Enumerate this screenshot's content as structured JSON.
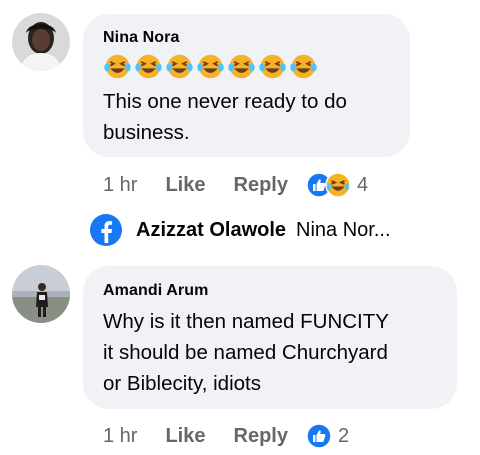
{
  "comments": [
    {
      "author": "Nina Nora",
      "emoji_row": [
        "laughing-tears-emoji",
        "laughing-tears-emoji",
        "laughing-tears-emoji",
        "laughing-tears-emoji",
        "laughing-tears-emoji",
        "laughing-tears-emoji",
        "laughing-tears-emoji"
      ],
      "text": "This one never ready to do\nbusiness.",
      "time": "1 hr",
      "like_label": "Like",
      "reply_label": "Reply",
      "reactions": [
        "like-reaction-icon",
        "haha-reaction-icon"
      ],
      "reaction_count": "4"
    },
    {
      "author": "Amandi Arum",
      "text": "Why is it then named FUNCITY\nit should be named Churchyard\nor Biblecity, idiots",
      "time": "1 hr",
      "like_label": "Like",
      "reply_label": "Reply",
      "reactions": [
        "like-reaction-icon"
      ],
      "reaction_count": "2"
    }
  ],
  "reply_preview": {
    "icon": "facebook-icon",
    "author": "Azizzat Olawole",
    "snippet": "Nina Nor..."
  },
  "colors": {
    "bubble": "#f0f2f5",
    "meta_text": "#65676b",
    "facebook_blue": "#1877f2",
    "haha_yellow": "#f7b125"
  }
}
